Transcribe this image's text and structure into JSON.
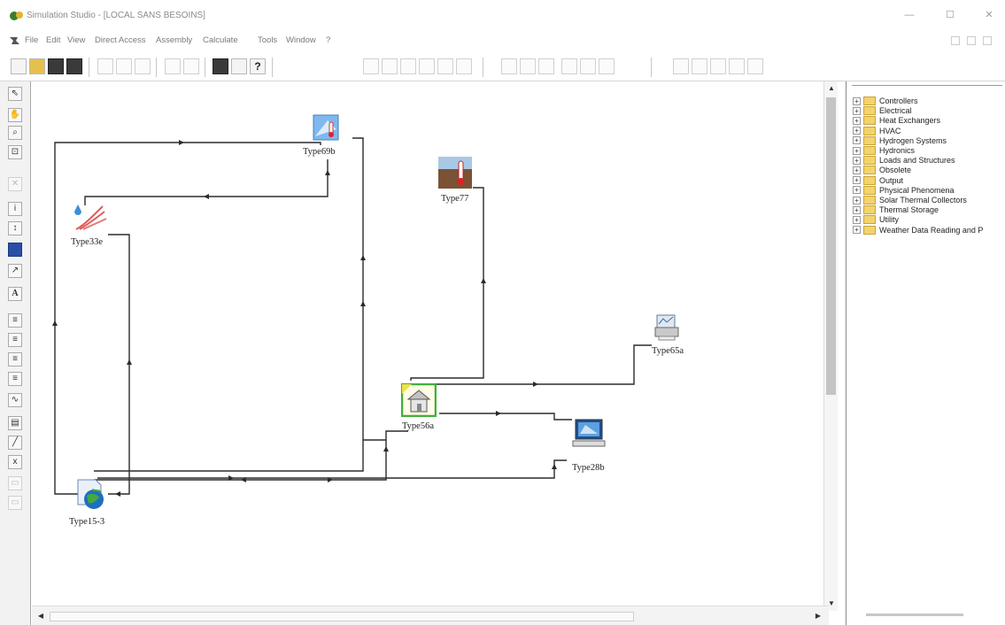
{
  "window": {
    "title": "Simulation Studio - [LOCAL SANS BESOINS]",
    "minimize": "—",
    "maximize": "☐",
    "close": "✕"
  },
  "menu": [
    "File",
    "Edit",
    "View",
    "Direct Access",
    "Assembly",
    "Calculate",
    "Tools",
    "Window",
    "?"
  ],
  "components": [
    {
      "label": "Type69b",
      "icon": "sky-temperature-icon"
    },
    {
      "label": "Type77",
      "icon": "ground-temperature-icon"
    },
    {
      "label": "Type33e",
      "icon": "psychrometrics-icon"
    },
    {
      "label": "Type65a",
      "icon": "online-plotter-icon"
    },
    {
      "label": "Type56a",
      "icon": "building-icon"
    },
    {
      "label": "Type28b",
      "icon": "simulation-summary-icon"
    },
    {
      "label": "Type15-3",
      "icon": "weather-data-icon"
    }
  ],
  "library": {
    "items": [
      "Controllers",
      "Electrical",
      "Heat Exchangers",
      "HVAC",
      "Hydrogen Systems",
      "Hydronics",
      "Loads and Structures",
      "Obsolete",
      "Output",
      "Physical Phenomena",
      "Solar Thermal Collectors",
      "Thermal Storage",
      "Utility",
      "Weather Data Reading and P"
    ]
  },
  "colors": {
    "connection": "#2b2b2b",
    "folder": "#f3d36b",
    "accent": "#2a4ea8"
  }
}
